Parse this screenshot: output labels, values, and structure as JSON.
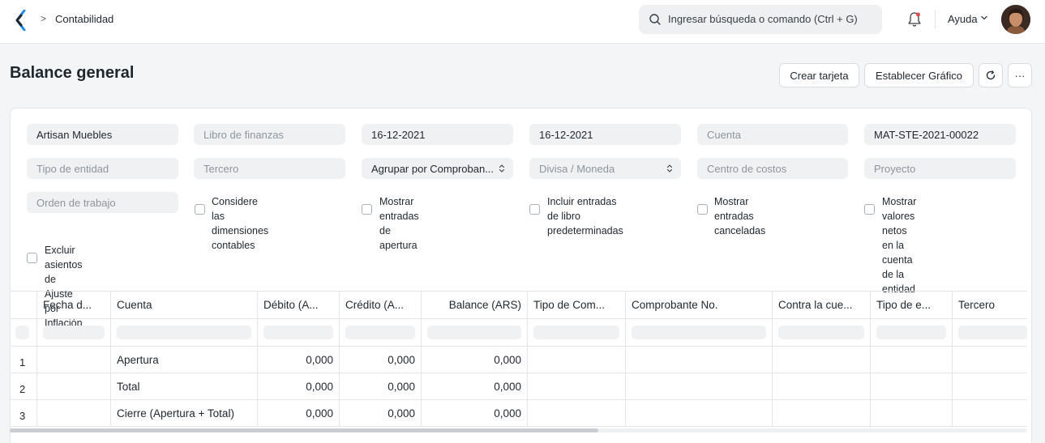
{
  "nav": {
    "breadcrumb": "Contabilidad",
    "search_placeholder": "Ingresar búsqueda o comando (Ctrl + G)",
    "help_label": "Ayuda"
  },
  "page": {
    "title": "Balance general",
    "btn_create_card": "Crear tarjeta",
    "btn_set_chart": "Establecer Gráfico",
    "btn_more": "···"
  },
  "filters": {
    "company": "Artisan Muebles",
    "finance_book": "Libro de finanzas",
    "from_date": "16-12-2021",
    "to_date": "16-12-2021",
    "account": "Cuenta",
    "voucher_no": "MAT-STE-2021-00022",
    "party_type": "Tipo de entidad",
    "party": "Tercero",
    "group_by": "Agrupar por Comproban...",
    "currency": "Divisa / Moneda",
    "cost_center": "Centro de costos",
    "project": "Proyecto",
    "work_order": "Orden de trabajo",
    "checkboxes": [
      {
        "line1": "Considere las dimensiones",
        "line2": "contables"
      },
      {
        "line1": "Mostrar entradas de",
        "line2": "apertura"
      },
      {
        "line1": "Incluir entradas de libro",
        "line2": "predeterminadas"
      },
      {
        "line1": "Mostrar entradas",
        "line2": "canceladas"
      },
      {
        "line1": "Mostrar valores netos en la",
        "line2": "cuenta de la entidad"
      },
      {
        "line1": "Excluir asientos de Ajuste",
        "line2": "por Inflación"
      }
    ]
  },
  "table": {
    "columns": [
      "Fecha d...",
      "Cuenta",
      "Débito (A...",
      "Crédito (A...",
      "Balance (ARS)",
      "Tipo de Com...",
      "Comprobante No.",
      "Contra la cue...",
      "Tipo de e...",
      "Tercero"
    ],
    "rows": [
      {
        "n": "1",
        "account": "Apertura",
        "debit": "0,000",
        "credit": "0,000",
        "balance": "0,000"
      },
      {
        "n": "2",
        "account": "Total",
        "debit": "0,000",
        "credit": "0,000",
        "balance": "0,000"
      },
      {
        "n": "3",
        "account": "Cierre (Apertura + Total)",
        "debit": "0,000",
        "credit": "0,000",
        "balance": "0,000"
      }
    ]
  },
  "colors": {
    "accent": "#1f272e",
    "field_bg": "#f0f1f3",
    "border": "#e2e6e9",
    "notification_dot": "#e24c4c"
  }
}
